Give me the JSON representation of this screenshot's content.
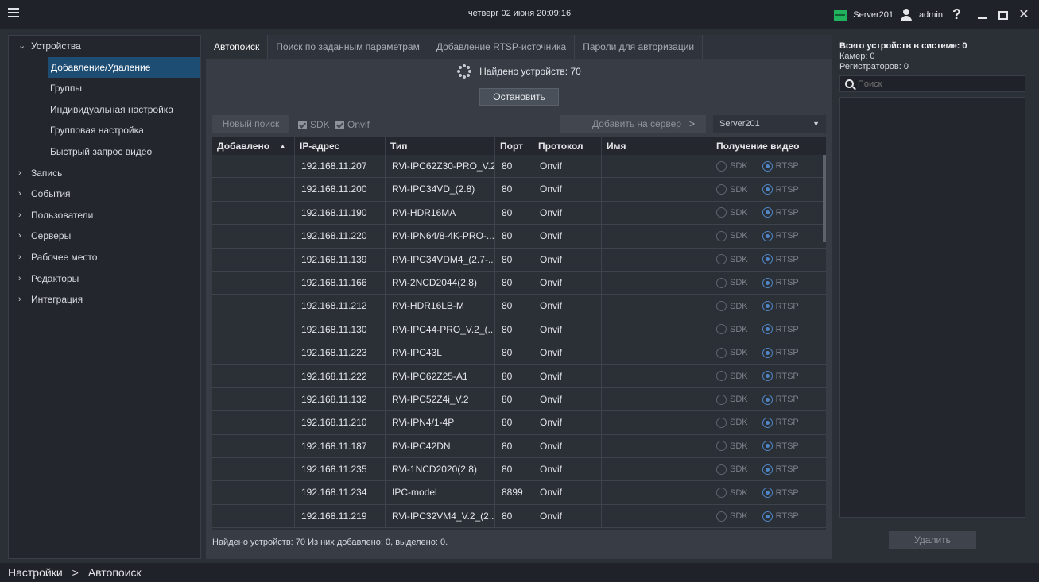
{
  "titlebar": {
    "datetime": "четверг 02 июня 20:09:16",
    "server": "Server201",
    "user": "admin",
    "help": "?"
  },
  "sidebar": {
    "items": [
      {
        "label": "Устройства",
        "expanded": true
      },
      {
        "label": "Добавление/Удаление",
        "sub": true,
        "active": true
      },
      {
        "label": "Группы",
        "sub": true
      },
      {
        "label": "Индивидуальная настройка",
        "sub": true
      },
      {
        "label": "Групповая настройка",
        "sub": true
      },
      {
        "label": "Быстрый запрос видео",
        "sub": true
      },
      {
        "label": "Запись"
      },
      {
        "label": "События"
      },
      {
        "label": "Пользователи"
      },
      {
        "label": "Серверы"
      },
      {
        "label": "Рабочее место"
      },
      {
        "label": "Редакторы"
      },
      {
        "label": "Интеграция"
      }
    ]
  },
  "tabs": [
    "Автопоиск",
    "Поиск по заданным параметрам",
    "Добавление RTSP-источника",
    "Пароли для авторизации"
  ],
  "search": {
    "found_text": "Найдено устройств: 70",
    "stop_label": "Остановить",
    "new_search_label": "Новый поиск",
    "sdk_label": "SDK",
    "onvif_label": "Onvif",
    "add_to_server_label": "Добавить на сервер",
    "server_select": "Server201"
  },
  "table": {
    "headers": [
      "Добавлено",
      "IP-адрес",
      "Тип",
      "Порт",
      "Протокол",
      "Имя",
      "Получение видео"
    ],
    "radio_sdk": "SDK",
    "radio_rtsp": "RTSP",
    "rows": [
      {
        "ip": "192.168.11.207",
        "type": "RVi-IPC62Z30-PRO_V.2",
        "port": "80",
        "protocol": "Onvif"
      },
      {
        "ip": "192.168.11.200",
        "type": "RVi-IPC34VD_(2.8)",
        "port": "80",
        "protocol": "Onvif"
      },
      {
        "ip": "192.168.11.190",
        "type": "RVi-HDR16MA",
        "port": "80",
        "protocol": "Onvif"
      },
      {
        "ip": "192.168.11.220",
        "type": "RVi-IPN64/8-4K-PRO-...",
        "port": "80",
        "protocol": "Onvif"
      },
      {
        "ip": "192.168.11.139",
        "type": "RVi-IPC34VDM4_(2.7-...",
        "port": "80",
        "protocol": "Onvif"
      },
      {
        "ip": "192.168.11.166",
        "type": "RVi-2NCD2044(2.8)",
        "port": "80",
        "protocol": "Onvif"
      },
      {
        "ip": "192.168.11.212",
        "type": "RVi-HDR16LB-M",
        "port": "80",
        "protocol": "Onvif"
      },
      {
        "ip": "192.168.11.130",
        "type": "RVi-IPC44-PRO_V.2_(...",
        "port": "80",
        "protocol": "Onvif"
      },
      {
        "ip": "192.168.11.223",
        "type": "RVi-IPC43L",
        "port": "80",
        "protocol": "Onvif"
      },
      {
        "ip": "192.168.11.222",
        "type": "RVi-IPC62Z25-A1",
        "port": "80",
        "protocol": "Onvif"
      },
      {
        "ip": "192.168.11.132",
        "type": "RVi-IPC52Z4i_V.2",
        "port": "80",
        "protocol": "Onvif"
      },
      {
        "ip": "192.168.11.210",
        "type": "RVi-IPN4/1-4P",
        "port": "80",
        "protocol": "Onvif"
      },
      {
        "ip": "192.168.11.187",
        "type": "RVi-IPC42DN",
        "port": "80",
        "protocol": "Onvif"
      },
      {
        "ip": "192.168.11.235",
        "type": "RVi-1NCD2020(2.8)",
        "port": "80",
        "protocol": "Onvif"
      },
      {
        "ip": "192.168.11.234",
        "type": "IPC-model",
        "port": "8899",
        "protocol": "Onvif"
      },
      {
        "ip": "192.168.11.219",
        "type": "RVi-IPC32VM4_V.2_(2...",
        "port": "80",
        "protocol": "Onvif"
      }
    ]
  },
  "status_line": "Найдено устройств: 70 Из них добавлено: 0, выделено: 0.",
  "right_panel": {
    "total": "Всего устройств в системе: 0",
    "cameras": "Камер: 0",
    "recorders": "Регистраторов: 0",
    "search_placeholder": "Поиск",
    "delete_label": "Удалить"
  },
  "breadcrumb": {
    "root": "Настройки",
    "separator": ">",
    "current": "Автопоиск"
  },
  "colors": {
    "accent": "#1e4d73",
    "server_status": "#20b25d",
    "radio_selected": "#4f86c6"
  }
}
